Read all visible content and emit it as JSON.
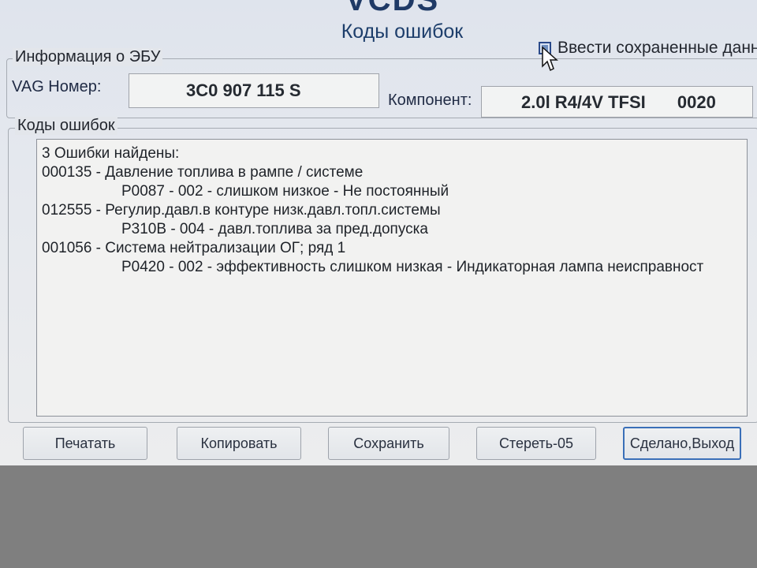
{
  "window": {
    "logo_fragment": "VCDS",
    "title": "Коды ошибок"
  },
  "saved_data": {
    "checked": false,
    "label": "Ввести сохраненные данн"
  },
  "ecu_info": {
    "legend": "Информация о ЭБУ",
    "vag_label": "VAG Номер:",
    "vag_value": "3C0 907 115 S",
    "component_label": "Компонент:",
    "component_value": "2.0l R4/4V TFSI",
    "component_code": "0020"
  },
  "fault_codes": {
    "legend": "Коды ошибок",
    "lines": [
      "3 Ошибки найдены:",
      "000135 - Давление топлива в рампе / системе",
      "P0087 - 002 - слишком низкое - Не постоянный",
      "012555 - Регулир.давл.в контуре низк.давл.топл.системы",
      "P310B - 004 - давл.топлива за пред.допуска",
      "001056 - Система нейтрализации ОГ; ряд 1",
      "P0420 - 002 - эффективность слишком низкая - Индикаторная лампа неисправност"
    ]
  },
  "buttons": {
    "print": "Печатать",
    "copy": "Копировать",
    "save": "Сохранить",
    "clear": "Стереть-05",
    "done": "Сделано,Выход"
  },
  "colors": {
    "accent": "#3a6fb8",
    "title": "#1d3e6b"
  }
}
